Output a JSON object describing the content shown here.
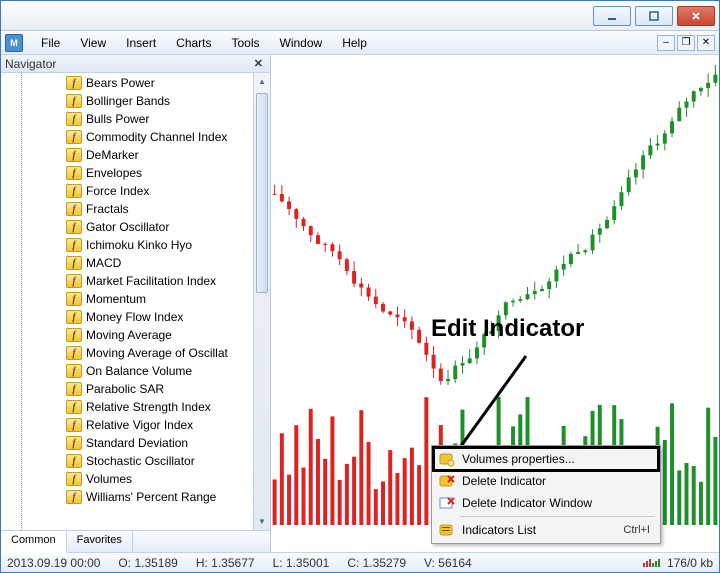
{
  "menubar": {
    "items": [
      "File",
      "View",
      "Insert",
      "Charts",
      "Tools",
      "Window",
      "Help"
    ]
  },
  "navigator": {
    "title": "Navigator",
    "tabs": {
      "common": "Common",
      "favorites": "Favorites"
    },
    "indicators": [
      "Bears Power",
      "Bollinger Bands",
      "Bulls Power",
      "Commodity Channel Index",
      "DeMarker",
      "Envelopes",
      "Force Index",
      "Fractals",
      "Gator Oscillator",
      "Ichimoku Kinko Hyo",
      "MACD",
      "Market Facilitation Index",
      "Momentum",
      "Money Flow Index",
      "Moving Average",
      "Moving Average of Oscillat",
      "On Balance Volume",
      "Parabolic SAR",
      "Relative Strength Index",
      "Relative Vigor Index",
      "Standard Deviation",
      "Stochastic Oscillator",
      "Volumes",
      "Williams' Percent Range"
    ]
  },
  "context_menu": {
    "properties": "Volumes properties...",
    "delete_indicator": "Delete Indicator",
    "delete_window": "Delete Indicator Window",
    "indicators_list": "Indicators List",
    "shortcut": "Ctrl+I"
  },
  "annotation": {
    "label": "Edit Indicator"
  },
  "status": {
    "datetime": "2013.09.19 00:00",
    "open_label": "O:",
    "open": "1.35189",
    "high_label": "H:",
    "high": "1.35677",
    "low_label": "L:",
    "low": "1.35001",
    "close_label": "C:",
    "close": "1.35279",
    "vol_label": "V:",
    "vol": "56164",
    "conn": "176/0 kb"
  },
  "colors": {
    "bull": "#1f8f2a",
    "bear": "#d22",
    "accent": "#1d6fd6"
  },
  "chart_data": {
    "type": "candlestick+volume",
    "x_count": 62,
    "ohlc_sample": {
      "O": 1.35189,
      "H": 1.35677,
      "L": 1.35001,
      "C": 1.35279
    },
    "y_visible_range": [
      1.345,
      1.362
    ],
    "volume_max_estimate": 60000,
    "note": "Exact per-bar OHLC/volume values are not labeled on the chart; only the status-bar values for the last bar are shown."
  }
}
